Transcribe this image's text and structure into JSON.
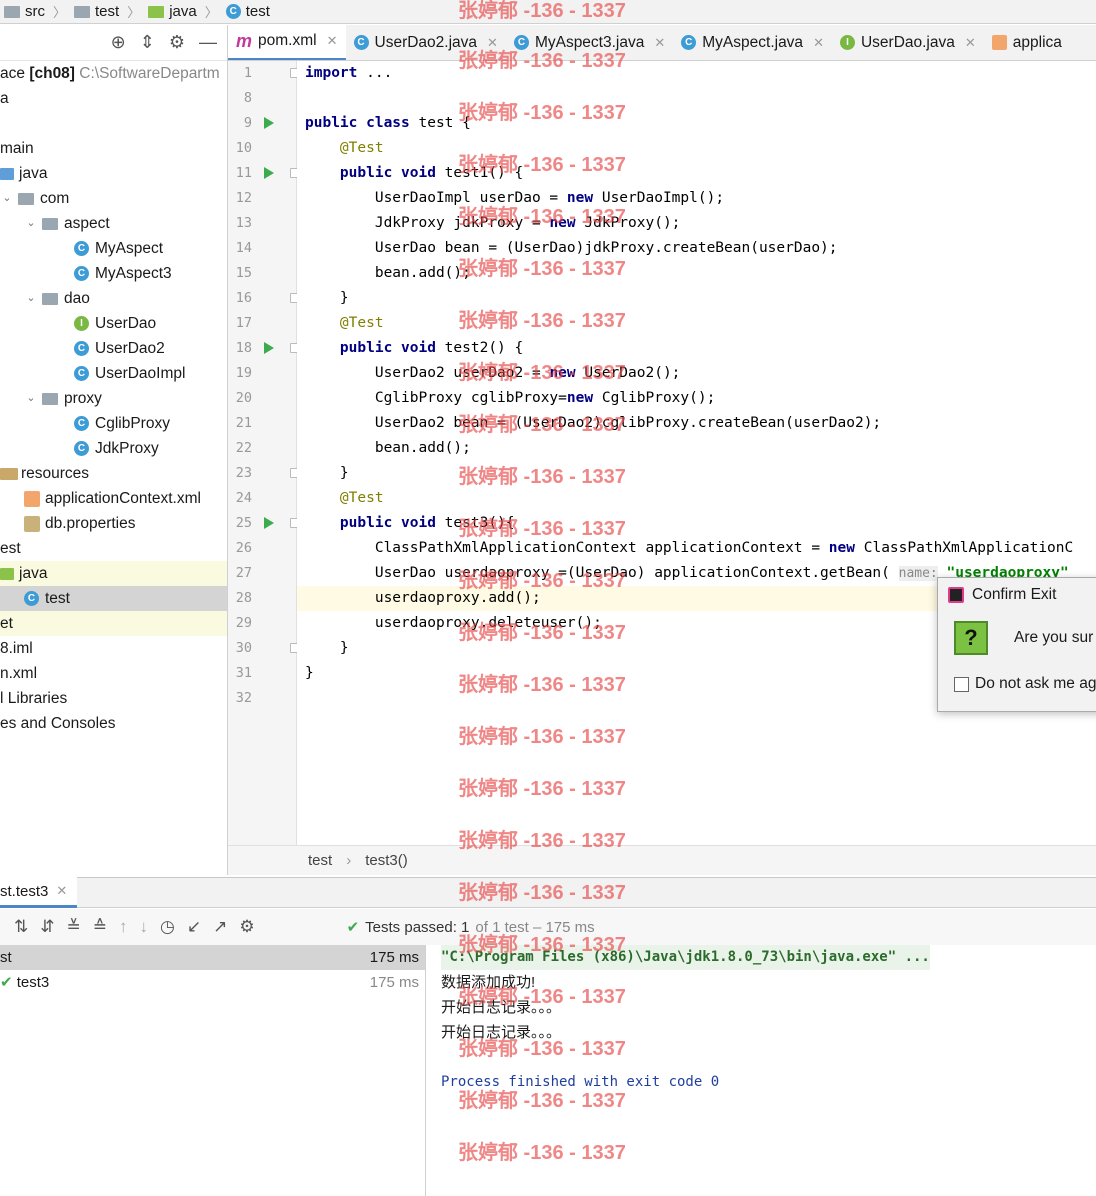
{
  "breadcrumbs": [
    "src",
    "test",
    "java",
    "test"
  ],
  "sidebar": {
    "project_prefix": "ace",
    "project_name": "[ch08]",
    "project_path": "C:\\SoftwareDepartm",
    "items": [
      {
        "label": "a"
      },
      {
        "label": "main"
      },
      {
        "label": "java"
      },
      {
        "label": "com"
      },
      {
        "label": "aspect"
      },
      {
        "label": "MyAspect"
      },
      {
        "label": "MyAspect3"
      },
      {
        "label": "dao"
      },
      {
        "label": "UserDao"
      },
      {
        "label": "UserDao2"
      },
      {
        "label": "UserDaoImpl"
      },
      {
        "label": "proxy"
      },
      {
        "label": "CglibProxy"
      },
      {
        "label": "JdkProxy"
      },
      {
        "label": "resources"
      },
      {
        "label": "applicationContext.xml"
      },
      {
        "label": "db.properties"
      },
      {
        "label": "est"
      },
      {
        "label": "java"
      },
      {
        "label": "test"
      },
      {
        "label": "et"
      },
      {
        "label": "8.iml"
      },
      {
        "label": "n.xml"
      },
      {
        "label": "l Libraries"
      },
      {
        "label": "es and Consoles"
      }
    ]
  },
  "tabs": [
    {
      "label": "pom.xml"
    },
    {
      "label": "UserDao2.java"
    },
    {
      "label": "MyAspect3.java"
    },
    {
      "label": "MyAspect.java"
    },
    {
      "label": "UserDao.java"
    },
    {
      "label": "applica"
    }
  ],
  "line_numbers": [
    "1",
    "8",
    "9",
    "10",
    "11",
    "12",
    "13",
    "14",
    "15",
    "16",
    "17",
    "18",
    "19",
    "20",
    "21",
    "22",
    "23",
    "24",
    "25",
    "26",
    "27",
    "28",
    "29",
    "30",
    "31",
    "32"
  ],
  "code": {
    "l1_kw": "import",
    "l1_rest": " ...",
    "l9_a": "public class",
    "l9_b": " test {",
    "ann": "@Test",
    "pv": "public void",
    "l11": " test1() {",
    "l12_a": "        UserDaoImpl userDao = ",
    "l12_kw": "new",
    "l12_b": " UserDaoImpl();",
    "l13_a": "        JdkProxy jdkProxy = ",
    "l13_kw": "new",
    "l13_b": " JdkProxy();",
    "l14": "        UserDao bean = (UserDao)jdkProxy.createBean(userDao);",
    "l15": "        bean.add();",
    "l16": "    }",
    "l18": " test2() {",
    "l19_a": "        UserDao2 userDao2 = ",
    "l19_kw": "new",
    "l19_b": " UserDao2();",
    "l20_a": "        CglibProxy cglibProxy=",
    "l20_kw": "new",
    "l20_b": " CglibProxy();",
    "l21": "        UserDao2 bean = (UserDao2)cglibProxy.createBean(userDao2);",
    "l22": "        bean.add();",
    "l23": "    }",
    "l25": " test3(){",
    "l26_a": "        ClassPathXmlApplicationContext applicationContext = ",
    "l26_kw": "new",
    "l26_b": " ClassPathXmlApplicationC",
    "l27_a": "        UserDao userdaoproxy =(UserDao) applicationContext.getBean( ",
    "l27_hint": "name:",
    "l27_str": " \"userdaoproxy\"",
    "l28": "        userdaoproxy.add();",
    "l29": "        userdaoproxy.deleteuser();",
    "l30": "    }",
    "l31": "}"
  },
  "editor_breadcrumb": [
    "test",
    "test3()"
  ],
  "run": {
    "tab_label": "st.test3",
    "status_bold": "Tests passed: 1",
    "status_rest": " of 1 test – 175 ms",
    "tree": [
      {
        "label": "st",
        "time": "175 ms"
      },
      {
        "label": "test3",
        "time": "175 ms"
      }
    ],
    "console": [
      "\"C:\\Program Files (x86)\\Java\\jdk1.8.0_73\\bin\\java.exe\" ...",
      "数据添加成功!",
      "开始日志记录。。。",
      "开始日志记录。。。",
      "Process finished with exit code 0"
    ]
  },
  "dialog": {
    "title": "Confirm Exit",
    "message": "Are you sur",
    "checkbox_label": "Do not ask me ag"
  },
  "watermark": "张婷郁 -136 - 1337",
  "colors": {
    "keyword": "#000080",
    "annotation": "#808000",
    "run_green": "#3cab4e",
    "watermark": "#e64646"
  }
}
